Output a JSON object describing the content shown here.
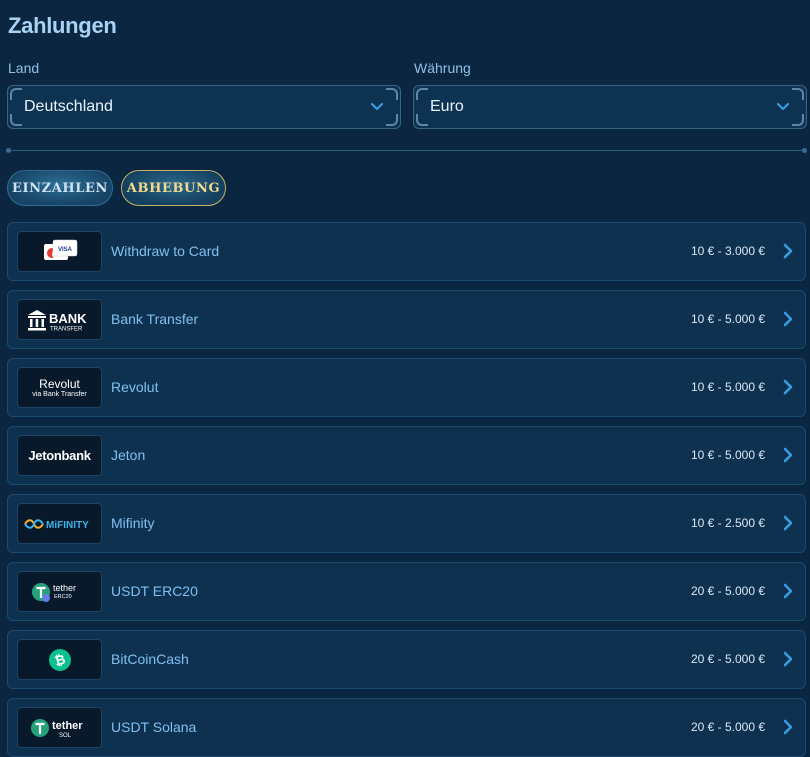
{
  "header": {
    "title": "Zahlungen"
  },
  "filters": {
    "country_label": "Land",
    "country_value": "Deutschland",
    "currency_label": "Währung",
    "currency_value": "Euro"
  },
  "tabs": {
    "deposit": "EINZAHLEN",
    "withdraw": "ABHEBUNG",
    "active": "withdraw"
  },
  "methods": [
    {
      "name": "Withdraw to Card",
      "range": "10 € - 3.000 €",
      "logo": "visa-card-icon",
      "logo_text": "VISA"
    },
    {
      "name": "Bank Transfer",
      "range": "10 € - 5.000 €",
      "logo": "bank-icon",
      "logo_text": "BANK",
      "logo_sub": "TRANSFER"
    },
    {
      "name": "Revolut",
      "range": "10 € - 5.000 €",
      "logo": "revolut-logo",
      "logo_text": "Revolut",
      "logo_sub": "via Bank Transfer"
    },
    {
      "name": "Jeton",
      "range": "10 € - 5.000 €",
      "logo": "jetonbank-logo",
      "logo_text": "Jetonbank"
    },
    {
      "name": "Mifinity",
      "range": "10 € - 2.500 €",
      "logo": "mifinity-logo",
      "logo_text": "MiFINITY"
    },
    {
      "name": "USDT ERC20",
      "range": "20 € - 5.000 €",
      "logo": "tether-icon",
      "logo_text": "tether",
      "logo_sub": "ERC20"
    },
    {
      "name": "BitCoinCash",
      "range": "20 € - 5.000 €",
      "logo": "bitcoin-cash-icon"
    },
    {
      "name": "USDT Solana",
      "range": "20 € - 5.000 €",
      "logo": "tether-icon",
      "logo_text": "tether",
      "logo_sub": "SOL"
    }
  ],
  "colors": {
    "background": "#0b2640",
    "accent": "#3b9be0",
    "gold": "#f3d98a"
  }
}
